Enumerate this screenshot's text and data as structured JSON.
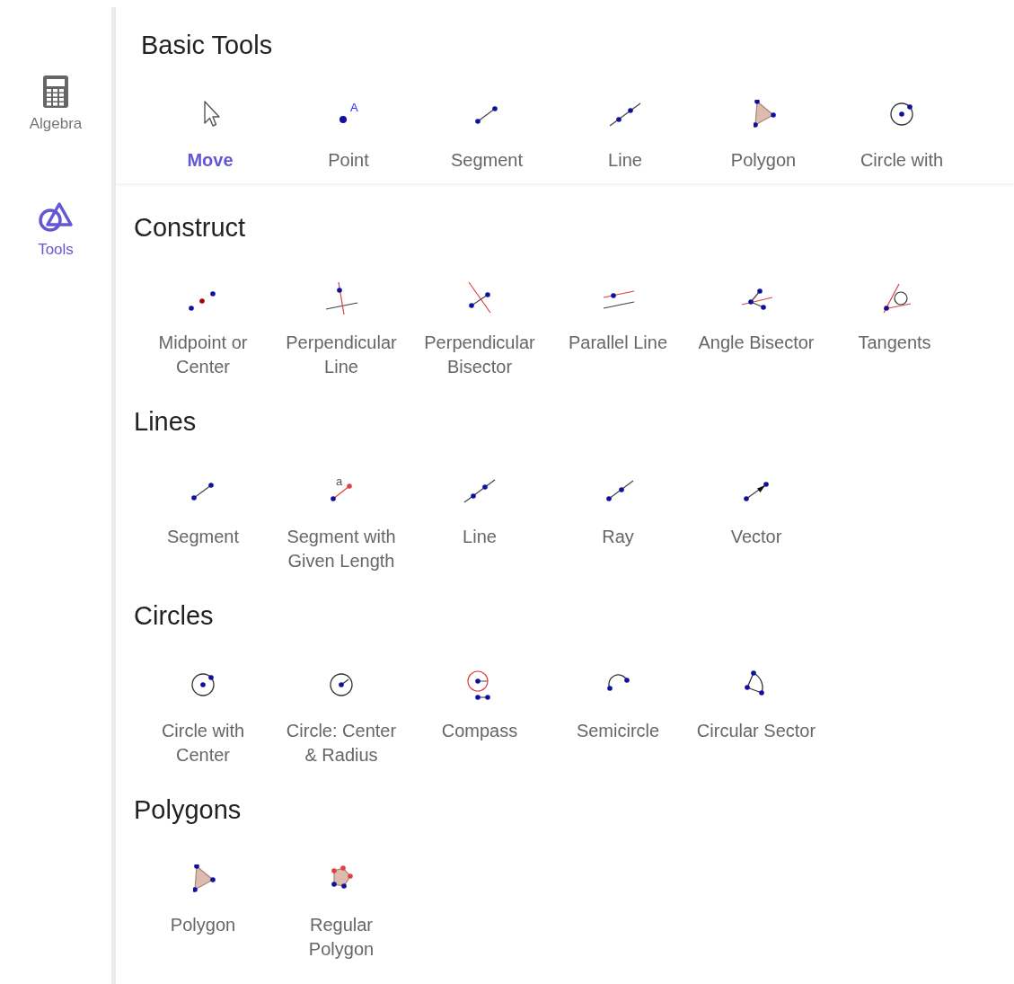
{
  "sidebar": {
    "items": [
      {
        "label": "Algebra",
        "kind": "calculator",
        "selected": false
      },
      {
        "label": "Tools",
        "kind": "shapes",
        "selected": true
      }
    ]
  },
  "sections": [
    {
      "title": "Basic Tools",
      "kind": "pinned",
      "tools": [
        {
          "label": "Move",
          "kind": "move",
          "selected": true
        },
        {
          "label": "Point",
          "kind": "point",
          "mark": "A",
          "selected": false
        },
        {
          "label": "Segment",
          "kind": "segment",
          "selected": false
        },
        {
          "label": "Line",
          "kind": "line",
          "selected": false
        },
        {
          "label": "Polygon",
          "kind": "polygon",
          "selected": false
        },
        {
          "label": "Circle with",
          "kind": "circle",
          "selected": false
        }
      ]
    },
    {
      "title": "Construct",
      "kind": "list",
      "tools": [
        {
          "label": "Midpoint or Center",
          "kind": "midpoint",
          "selected": false
        },
        {
          "label": "Perpendicular Line",
          "kind": "perpendicular",
          "selected": false
        },
        {
          "label": "Perpendicular Bisector",
          "kind": "bisector",
          "selected": false
        },
        {
          "label": "Parallel Line",
          "kind": "parallel",
          "selected": false
        },
        {
          "label": "Angle Bisector",
          "kind": "angle",
          "selected": false
        },
        {
          "label": "Tangents",
          "kind": "tangents",
          "selected": false
        }
      ]
    },
    {
      "title": "Lines",
      "kind": "list",
      "tools": [
        {
          "label": "Segment",
          "kind": "segment",
          "selected": false
        },
        {
          "label": "Segment with Given Length",
          "kind": "length",
          "mark": "a",
          "selected": false
        },
        {
          "label": "Line",
          "kind": "line",
          "selected": false
        },
        {
          "label": "Ray",
          "kind": "ray",
          "selected": false
        },
        {
          "label": "Vector",
          "kind": "vector",
          "selected": false
        }
      ]
    },
    {
      "title": "Circles",
      "kind": "list",
      "tools": [
        {
          "label": "Circle with Center",
          "kind": "circle",
          "selected": false
        },
        {
          "label": "Circle: Center & Radius",
          "kind": "radius",
          "selected": false
        },
        {
          "label": "Compass",
          "kind": "compass",
          "selected": false
        },
        {
          "label": "Semicircle",
          "kind": "semicircle",
          "selected": false
        },
        {
          "label": "Circular Sector",
          "kind": "sector",
          "selected": false
        }
      ]
    },
    {
      "title": "Polygons",
      "kind": "list",
      "tools": [
        {
          "label": "Polygon",
          "kind": "polygon",
          "selected": false
        },
        {
          "label": "Regular Polygon",
          "kind": "regular",
          "selected": false
        }
      ]
    }
  ]
}
